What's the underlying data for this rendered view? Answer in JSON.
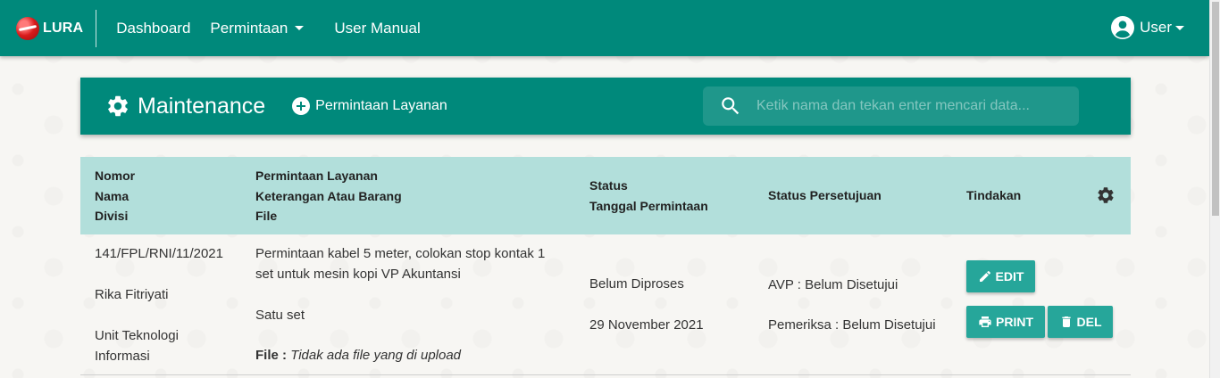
{
  "navbar": {
    "brand": "LURA",
    "links": [
      "Dashboard",
      "Permintaan",
      "User Manual"
    ],
    "user": "User"
  },
  "header": {
    "title": "Maintenance",
    "add_button": "Permintaan Layanan",
    "search_placeholder": "Ketik nama dan tekan enter mencari data..."
  },
  "table": {
    "headers": {
      "col1": [
        "Nomor",
        "Nama",
        "Divisi"
      ],
      "col2": [
        "Permintaan Layanan",
        "Keterangan Atau Barang",
        "File"
      ],
      "col3": [
        "Status",
        "Tanggal Permintaan"
      ],
      "col4": "Status Persetujuan",
      "col5": "Tindakan"
    },
    "rows": [
      {
        "nomor": "141/FPL/RNI/11/2021",
        "nama": "Rika Fitriyati",
        "divisi_line1": "Unit Teknologi",
        "divisi_line2": "Informasi",
        "permintaan_line1": "Permintaan kabel 5 meter, colokan stop kontak 1",
        "permintaan_line2": "set untuk mesin kopi VP Akuntansi",
        "keterangan": "Satu set",
        "file_label": "File :",
        "file_value": "Tidak ada file yang di upload",
        "status": "Belum Diproses",
        "tanggal": "29 November 2021",
        "persetujuan_avp": "AVP : Belum Disetujui",
        "persetujuan_pemeriksa": "Pemeriksa : Belum Disetujui",
        "actions": {
          "edit": "EDIT",
          "print": "PRINT",
          "del": "DEL"
        }
      }
    ]
  },
  "colors": {
    "primary": "#00897b",
    "header_row": "#b2dfdb",
    "button": "#26a69a"
  },
  "icons": [
    "gear-icon",
    "plus-circle-icon",
    "search-icon",
    "user-circle-icon",
    "pencil-icon",
    "printer-icon",
    "trash-icon"
  ]
}
